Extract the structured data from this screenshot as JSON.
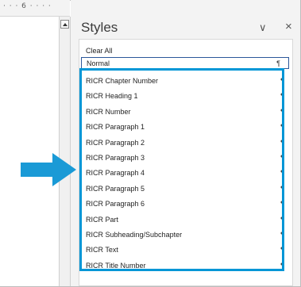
{
  "ruler": {
    "text": "· · · 6 · · · ·"
  },
  "pane": {
    "title": "Styles",
    "chevron": "∨",
    "close": "×"
  },
  "styles": {
    "clear_all": "Clear All",
    "normal": "Normal",
    "pilcrow": "¶",
    "items": [
      "RICR Chapter Number",
      "RICR Heading 1",
      "RICR Number",
      "RICR Paragraph 1",
      "RICR Paragraph 2",
      "RICR Paragraph 3",
      "RICR Paragraph 4",
      "RICR Paragraph 5",
      "RICR Paragraph 6",
      "RICR Part",
      "RICR Subheading/Subchapter",
      "RICR Text",
      "RICR Title Number"
    ]
  },
  "colors": {
    "highlight": "#0096d6",
    "pane_bg": "#f3f3f3",
    "selected_border": "#2b579a"
  },
  "icons": {
    "arrow": "right-arrow-icon",
    "scroll": "scroll-up-icon"
  }
}
